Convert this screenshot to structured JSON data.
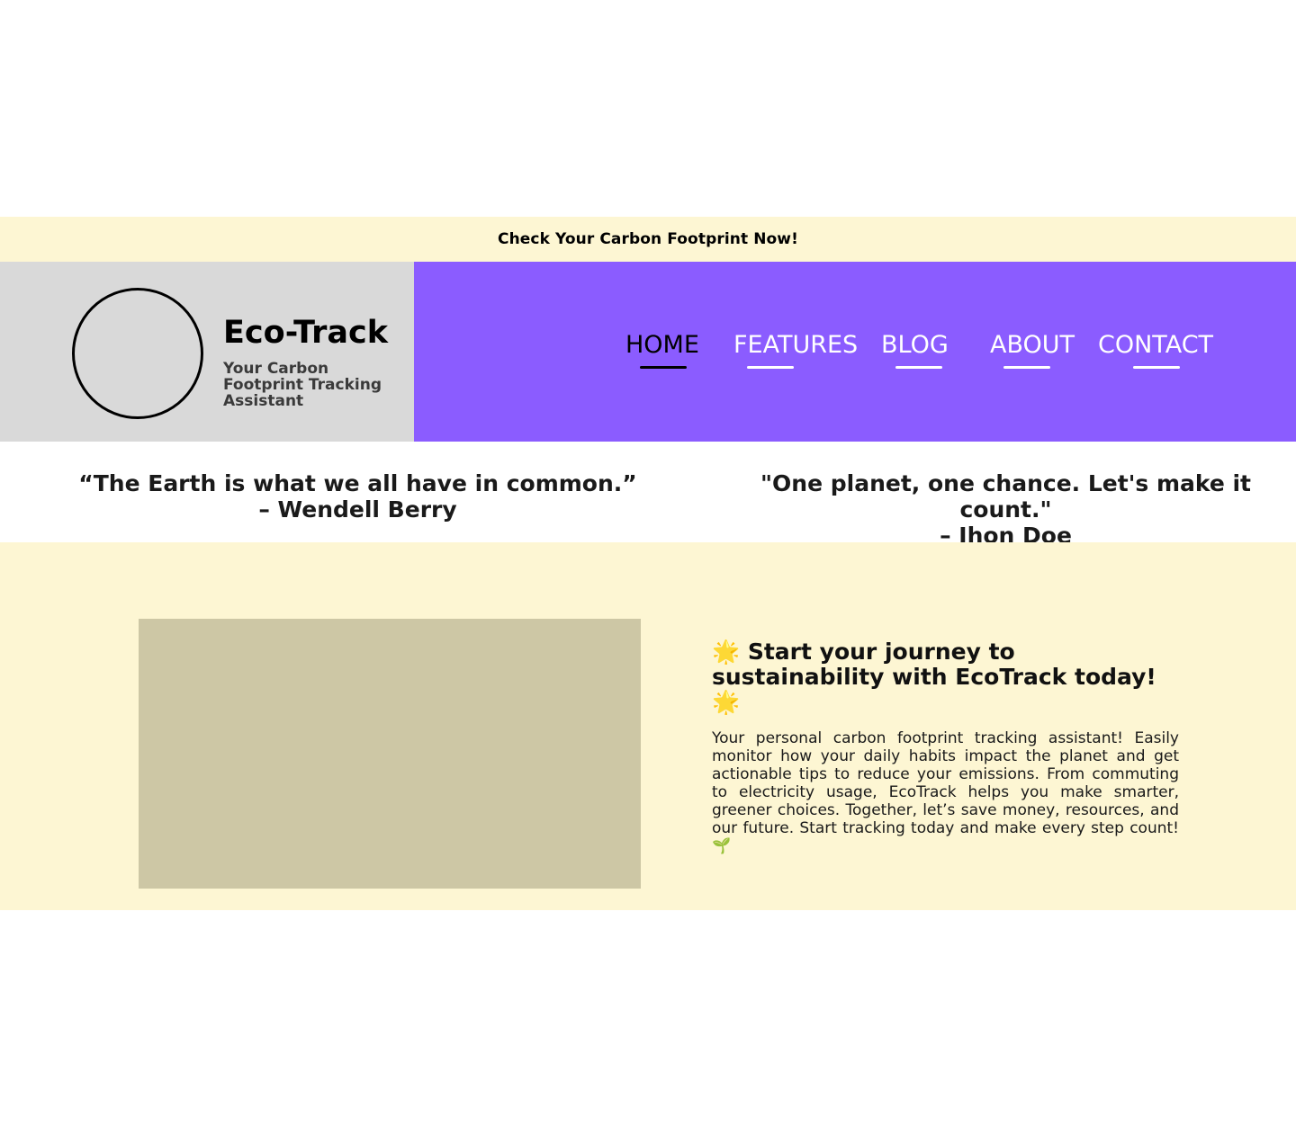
{
  "banner": {
    "cta_label": "Check Your Carbon Footprint Now!"
  },
  "brand": {
    "logo_icon": "circle-logo",
    "title": "Eco-Track",
    "subtitle": "Your Carbon Footprint Tracking Assistant"
  },
  "nav": {
    "items": [
      {
        "label": "HOME",
        "active": true
      },
      {
        "label": "FEATURES",
        "active": false
      },
      {
        "label": "BLOG",
        "active": false
      },
      {
        "label": "ABOUT",
        "active": false
      },
      {
        "label": "CONTACT",
        "active": false
      }
    ]
  },
  "quotes": [
    {
      "text": "“The Earth is what we all have in common.”",
      "author": "– Wendell Berry"
    },
    {
      "text": "\"One planet, one chance. Let's make it count.\"",
      "author": "– Jhon Doe"
    }
  ],
  "hero": {
    "title": "🌟 Start your journey to sustainability with EcoTrack today! 🌟",
    "body": "Your personal carbon footprint tracking assistant! Easily monitor how your daily habits impact the planet and get actionable tips to reduce your emissions. From commuting to electricity usage, EcoTrack helps you make smarter, greener choices. Together, let’s save money, resources, and our future. Start tracking today and make every step count! 🌱"
  },
  "colors": {
    "banner_bg": "#fdf6d3",
    "brand_bg": "#d9d9d9",
    "nav_bg": "#8b5cff",
    "hero_bg": "#fdf6d3",
    "image_placeholder": "#cdc7a5"
  }
}
